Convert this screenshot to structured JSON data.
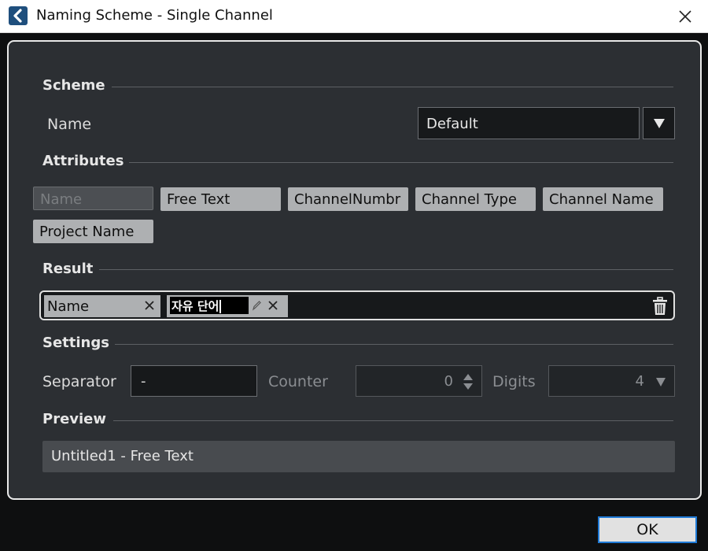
{
  "window": {
    "title": "Naming Scheme - Single Channel",
    "app_icon": "cubase-logo-icon",
    "close_icon": "close-icon"
  },
  "scheme": {
    "section_title": "Scheme",
    "name_label": "Name",
    "selected_value": "Default"
  },
  "attributes": {
    "section_title": "Attributes",
    "items": [
      {
        "label": "Name",
        "state": "disabled"
      },
      {
        "label": "Free Text",
        "state": "enabled"
      },
      {
        "label": "ChannelNumbr",
        "state": "enabled"
      },
      {
        "label": "Channel Type",
        "state": "enabled"
      },
      {
        "label": "Channel Name",
        "state": "enabled"
      },
      {
        "label": "Project Name",
        "state": "enabled"
      }
    ]
  },
  "result": {
    "section_title": "Result",
    "tokens": [
      {
        "label": "Name"
      },
      {
        "label": "자유 단어",
        "editing": true
      }
    ]
  },
  "settings": {
    "section_title": "Settings",
    "separator_label": "Separator",
    "separator_value": "-",
    "counter_label": "Counter",
    "counter_value": "0",
    "digits_label": "Digits",
    "digits_value": "4"
  },
  "preview": {
    "section_title": "Preview",
    "value": "Untitled1 - Free Text"
  },
  "footer": {
    "ok_label": "OK"
  },
  "colors": {
    "panel_bg": "#2c2f33",
    "chip_bg": "#aeb0b2",
    "focus_border": "#1f7ad6"
  }
}
